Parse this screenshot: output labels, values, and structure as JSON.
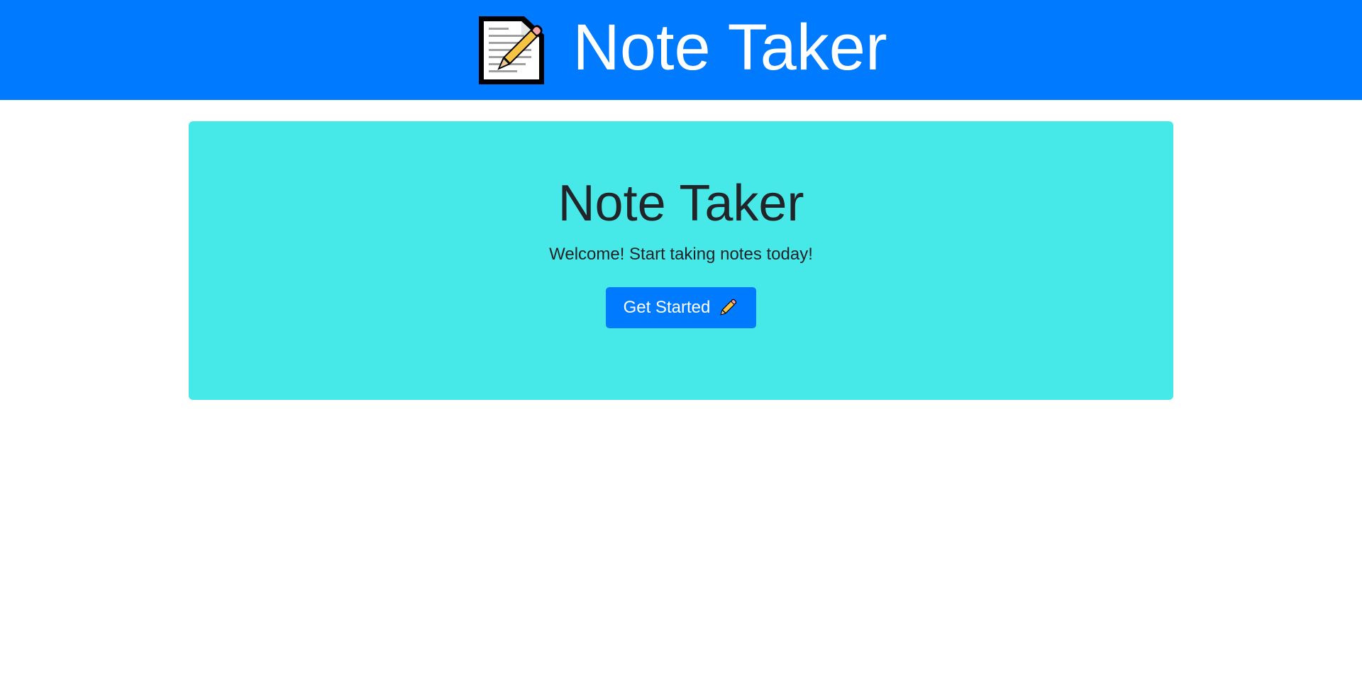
{
  "navbar": {
    "brand_icon": "memo-icon",
    "title": "Note Taker",
    "background": "#007bff"
  },
  "hero": {
    "title": "Note Taker",
    "lead": "Welcome! Start taking notes today!",
    "background": "#47e8e8",
    "button": {
      "label": "Get Started",
      "icon": "pencil-icon",
      "background": "#007bff"
    }
  }
}
